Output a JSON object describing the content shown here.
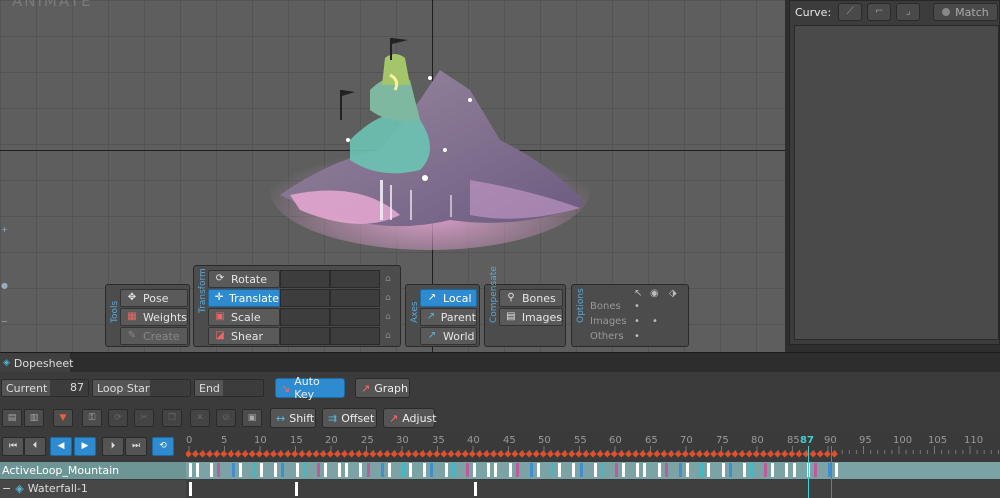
{
  "viewport": {
    "logo": "ANIMATE"
  },
  "curve_panel": {
    "label": "Curve:",
    "match_label": "Match"
  },
  "tools": {
    "title": "Tools",
    "pose": "Pose",
    "weights": "Weights",
    "create": "Create"
  },
  "transform": {
    "title": "Transform",
    "rotate": "Rotate",
    "translate": "Translate",
    "scale": "Scale",
    "shear": "Shear"
  },
  "axes": {
    "title": "Axes",
    "local": "Local",
    "parent": "Parent",
    "world": "World"
  },
  "compensate": {
    "title": "Compensate",
    "bones": "Bones",
    "images": "Images"
  },
  "options": {
    "title": "Options",
    "bones": "Bones",
    "images": "Images",
    "others": "Others"
  },
  "dopesheet": {
    "tab": "Dopesheet",
    "current_label": "Current",
    "current_value": "87",
    "loop_start_label": "Loop Start",
    "end_label": "End",
    "auto_key": "Auto Key",
    "graph": "Graph",
    "shift": "Shift",
    "offset": "Offset",
    "adjust": "Adjust",
    "ruler": [
      "0",
      "5",
      "10",
      "15",
      "20",
      "25",
      "30",
      "35",
      "40",
      "45",
      "50",
      "55",
      "60",
      "65",
      "70",
      "75",
      "80",
      "85",
      "87",
      "90",
      "95",
      "100",
      "105",
      "110"
    ],
    "tracks": [
      "ActiveLoop_Mountain",
      "Waterfall-1"
    ]
  },
  "colors": {
    "accent": "#2f8bd0",
    "playhead": "#3fd0d0",
    "key": "#e0502c",
    "track": "#7ba3a5"
  }
}
